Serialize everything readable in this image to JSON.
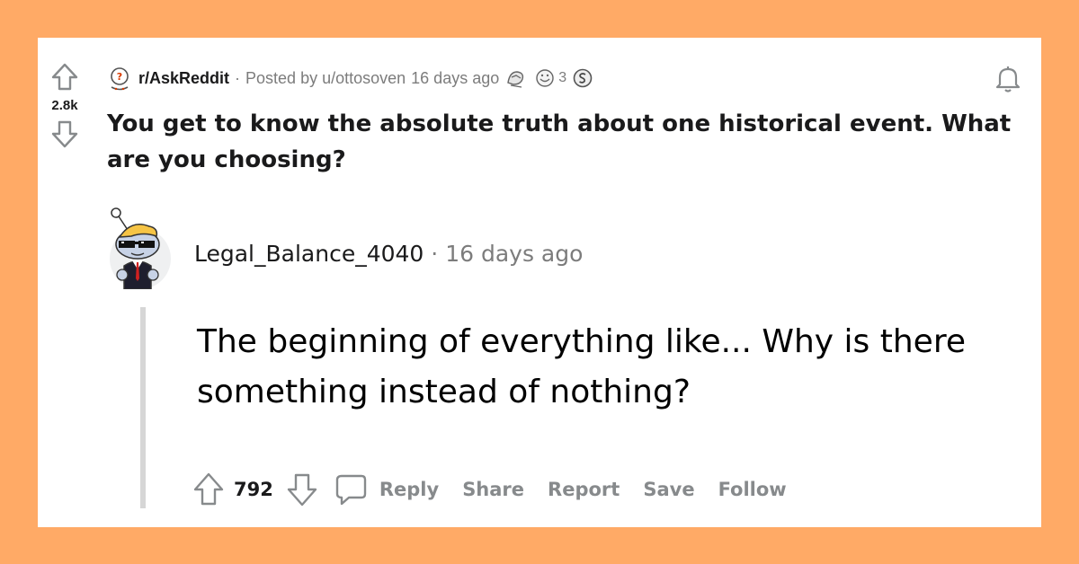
{
  "post": {
    "score": "2.8k",
    "subreddit": "r/AskReddit",
    "separator": "·",
    "posted_by": "Posted by u/ottosoven",
    "age": "16 days ago",
    "award_count": "3",
    "title": "You get to know the absolute truth about one historical event. What are you choosing?"
  },
  "comment": {
    "author": "Legal_Balance_4040",
    "separator": "·",
    "age": "16 days ago",
    "body": "The beginning of everything like... Why is there something instead of nothing?",
    "score": "792",
    "actions": {
      "reply": "Reply",
      "share": "Share",
      "report": "Report",
      "save": "Save",
      "follow": "Follow"
    }
  },
  "colors": {
    "background": "#ffaa66",
    "card": "#ffffff",
    "text": "#1a1a1b",
    "muted": "#7c7c7c",
    "thread_line": "#d6d6d6"
  },
  "icons": [
    "upvote-icon",
    "downvote-icon",
    "subreddit-icon",
    "award-icon",
    "notification-bell-icon",
    "comment-icon",
    "snoo-avatar-icon"
  ]
}
